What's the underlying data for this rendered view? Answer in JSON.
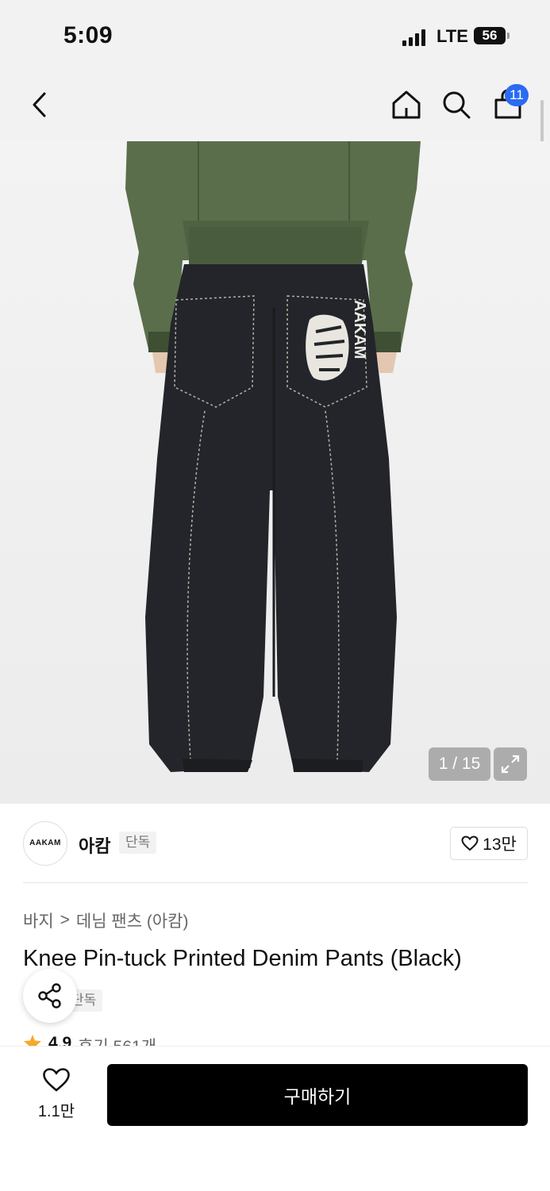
{
  "status_bar": {
    "time": "5:09",
    "network": "LTE",
    "battery": "56"
  },
  "nav": {
    "cart_count": "11"
  },
  "gallery": {
    "counter": "1 / 15",
    "print_text": "AAKAM"
  },
  "brand": {
    "logo_text": "AAKAM",
    "name": "아캄",
    "tag": "단독",
    "like_count": "13만"
  },
  "breadcrumb": {
    "category": "바지",
    "separator": ">",
    "subcategory": "데님 팬츠 (아캄)"
  },
  "product": {
    "title": "Knee Pin-tuck Printed Denim Pants (Black)",
    "tag": "단독",
    "rating": "4.9",
    "review_label": "후기 561개"
  },
  "bottom_bar": {
    "fav_count": "1.1만",
    "buy_label": "구매하기"
  },
  "colors": {
    "accent_badge": "#2a6bf2",
    "buy_button": "#000000",
    "star": "#f7a928"
  }
}
